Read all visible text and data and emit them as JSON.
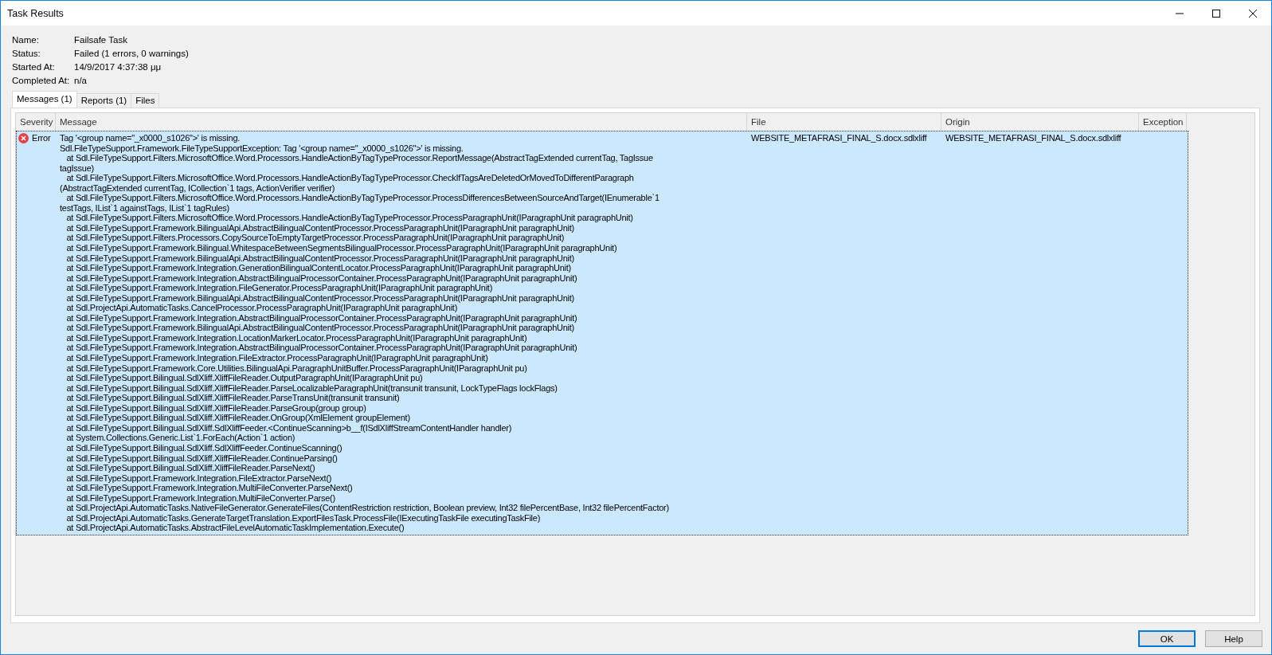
{
  "window": {
    "title": "Task Results"
  },
  "details": [
    {
      "label": "Name:",
      "value": "Failsafe Task"
    },
    {
      "label": "Status:",
      "value": "Failed (1 errors, 0 warnings)"
    },
    {
      "label": "Started At:",
      "value": "14/9/2017 4:37:38 μμ"
    },
    {
      "label": "Completed At:",
      "value": "n/a"
    }
  ],
  "tabs": [
    {
      "label": "Messages (1)",
      "selected": true
    },
    {
      "label": "Reports (1)",
      "selected": false
    },
    {
      "label": "Files",
      "selected": false
    }
  ],
  "table": {
    "columns": [
      "Severity",
      "Message",
      "File",
      "Origin",
      "Exception"
    ],
    "rows": [
      {
        "severity": "Error",
        "kind": "error",
        "selected": true,
        "file": "WEBSITE_METAFRASI_FINAL_S.docx.sdlxliff",
        "origin": "WEBSITE_METAFRASI_FINAL_S.docx.sdlxliff",
        "message_lines": [
          "Tag '<group name=\"_x0000_s1026\">' is missing.",
          "Sdl.FileTypeSupport.Framework.FileTypeSupportException: Tag '<group name=\"_x0000_s1026\">' is missing.",
          "   at Sdl.FileTypeSupport.Filters.MicrosoftOffice.Word.Processors.HandleActionByTagTypeProcessor.ReportMessage(AbstractTagExtended currentTag, TagIssue",
          "tagIssue)",
          "   at Sdl.FileTypeSupport.Filters.MicrosoftOffice.Word.Processors.HandleActionByTagTypeProcessor.CheckIfTagsAreDeletedOrMovedToDifferentParagraph",
          "(AbstractTagExtended currentTag, ICollection`1 tags, ActionVerifier verifier)",
          "   at Sdl.FileTypeSupport.Filters.MicrosoftOffice.Word.Processors.HandleActionByTagTypeProcessor.ProcessDifferencesBetweenSourceAndTarget(IEnumerable`1",
          "testTags, IList`1 againstTags, IList`1 tagRules)",
          "   at Sdl.FileTypeSupport.Filters.MicrosoftOffice.Word.Processors.HandleActionByTagTypeProcessor.ProcessParagraphUnit(IParagraphUnit paragraphUnit)",
          "   at Sdl.FileTypeSupport.Framework.BilingualApi.AbstractBilingualContentProcessor.ProcessParagraphUnit(IParagraphUnit paragraphUnit)",
          "   at Sdl.FileTypeSupport.Filters.Processors.CopySourceToEmptyTargetProcessor.ProcessParagraphUnit(IParagraphUnit paragraphUnit)",
          "   at Sdl.FileTypeSupport.Framework.Bilingual.WhitespaceBetweenSegmentsBilingualProcessor.ProcessParagraphUnit(IParagraphUnit paragraphUnit)",
          "   at Sdl.FileTypeSupport.Framework.BilingualApi.AbstractBilingualContentProcessor.ProcessParagraphUnit(IParagraphUnit paragraphUnit)",
          "   at Sdl.FileTypeSupport.Framework.Integration.GenerationBilingualContentLocator.ProcessParagraphUnit(IParagraphUnit paragraphUnit)",
          "   at Sdl.FileTypeSupport.Framework.Integration.AbstractBilingualProcessorContainer.ProcessParagraphUnit(IParagraphUnit paragraphUnit)",
          "   at Sdl.FileTypeSupport.Framework.Integration.FileGenerator.ProcessParagraphUnit(IParagraphUnit paragraphUnit)",
          "   at Sdl.FileTypeSupport.Framework.BilingualApi.AbstractBilingualContentProcessor.ProcessParagraphUnit(IParagraphUnit paragraphUnit)",
          "   at Sdl.ProjectApi.AutomaticTasks.CancelProcessor.ProcessParagraphUnit(IParagraphUnit paragraphUnit)",
          "   at Sdl.FileTypeSupport.Framework.Integration.AbstractBilingualProcessorContainer.ProcessParagraphUnit(IParagraphUnit paragraphUnit)",
          "   at Sdl.FileTypeSupport.Framework.BilingualApi.AbstractBilingualContentProcessor.ProcessParagraphUnit(IParagraphUnit paragraphUnit)",
          "   at Sdl.FileTypeSupport.Framework.Integration.LocationMarkerLocator.ProcessParagraphUnit(IParagraphUnit paragraphUnit)",
          "   at Sdl.FileTypeSupport.Framework.Integration.AbstractBilingualProcessorContainer.ProcessParagraphUnit(IParagraphUnit paragraphUnit)",
          "   at Sdl.FileTypeSupport.Framework.Integration.FileExtractor.ProcessParagraphUnit(IParagraphUnit paragraphUnit)",
          "   at Sdl.FileTypeSupport.Framework.Core.Utilities.BilingualApi.ParagraphUnitBuffer.ProcessParagraphUnit(IParagraphUnit pu)",
          "   at Sdl.FileTypeSupport.Bilingual.SdlXliff.XliffFileReader.OutputParagraphUnit(IParagraphUnit pu)",
          "   at Sdl.FileTypeSupport.Bilingual.SdlXliff.XliffFileReader.ParseLocalizableParagraphUnit(transunit transunit, LockTypeFlags lockFlags)",
          "   at Sdl.FileTypeSupport.Bilingual.SdlXliff.XliffFileReader.ParseTransUnit(transunit transunit)",
          "   at Sdl.FileTypeSupport.Bilingual.SdlXliff.XliffFileReader.ParseGroup(group group)",
          "   at Sdl.FileTypeSupport.Bilingual.SdlXliff.XliffFileReader.OnGroup(XmlElement groupElement)",
          "   at Sdl.FileTypeSupport.Bilingual.SdlXliff.SdlXliffFeeder.<ContinueScanning>b__f(ISdlXliffStreamContentHandler handler)",
          "   at System.Collections.Generic.List`1.ForEach(Action`1 action)",
          "   at Sdl.FileTypeSupport.Bilingual.SdlXliff.SdlXliffFeeder.ContinueScanning()",
          "   at Sdl.FileTypeSupport.Bilingual.SdlXliff.XliffFileReader.ContinueParsing()",
          "   at Sdl.FileTypeSupport.Bilingual.SdlXliff.XliffFileReader.ParseNext()",
          "   at Sdl.FileTypeSupport.Framework.Integration.FileExtractor.ParseNext()",
          "   at Sdl.FileTypeSupport.Framework.Integration.MultiFileConverter.ParseNext()",
          "   at Sdl.FileTypeSupport.Framework.Integration.MultiFileConverter.Parse()",
          "   at Sdl.ProjectApi.AutomaticTasks.NativeFileGenerator.GenerateFiles(ContentRestriction restriction, Boolean preview, Int32 filePercentBase, Int32 filePercentFactor)",
          "   at Sdl.ProjectApi.AutomaticTasks.GenerateTargetTranslation.ExportFilesTask.ProcessFile(IExecutingTaskFile executingTaskFile)",
          "   at Sdl.ProjectApi.AutomaticTasks.AbstractFileLevelAutomaticTaskImplementation.Execute()"
        ]
      }
    ]
  },
  "buttons": [
    {
      "label": "OK",
      "default": true
    },
    {
      "label": "Help",
      "default": false
    }
  ]
}
